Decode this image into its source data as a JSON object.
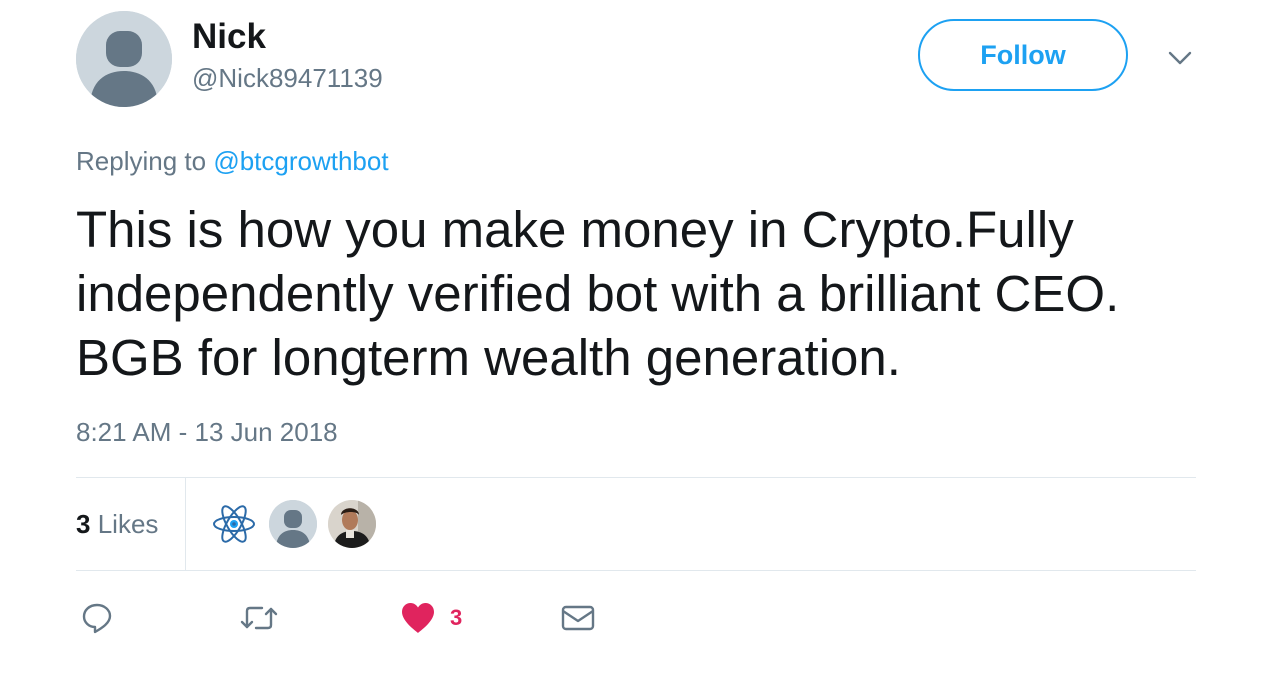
{
  "user": {
    "display_name": "Nick",
    "handle": "@Nick89471139",
    "avatar_icon": "default-egg-avatar"
  },
  "header": {
    "follow_label": "Follow",
    "caret_icon": "chevron-down-icon"
  },
  "reply": {
    "prefix": "Replying to",
    "mention": "@btcgrowthbot"
  },
  "tweet": {
    "text": "This is how you make money in Crypto.Fully independently verified bot with a brilliant CEO. BGB for longterm wealth generation.",
    "timestamp": "8:21 AM - 13 Jun 2018"
  },
  "stats": {
    "likes_number": "3",
    "likes_label": "Likes",
    "likers": [
      {
        "icon": "atom-icon"
      },
      {
        "icon": "default-avatar-icon"
      },
      {
        "icon": "person-photo-avatar"
      }
    ]
  },
  "actions": {
    "reply_icon": "reply-icon",
    "retweet_icon": "retweet-icon",
    "like_icon": "heart-icon",
    "like_count": "3",
    "dm_icon": "envelope-icon"
  },
  "colors": {
    "accent": "#1da1f2",
    "like": "#e0245e",
    "secondary_text": "#657786",
    "divider": "#e1e8ed"
  }
}
